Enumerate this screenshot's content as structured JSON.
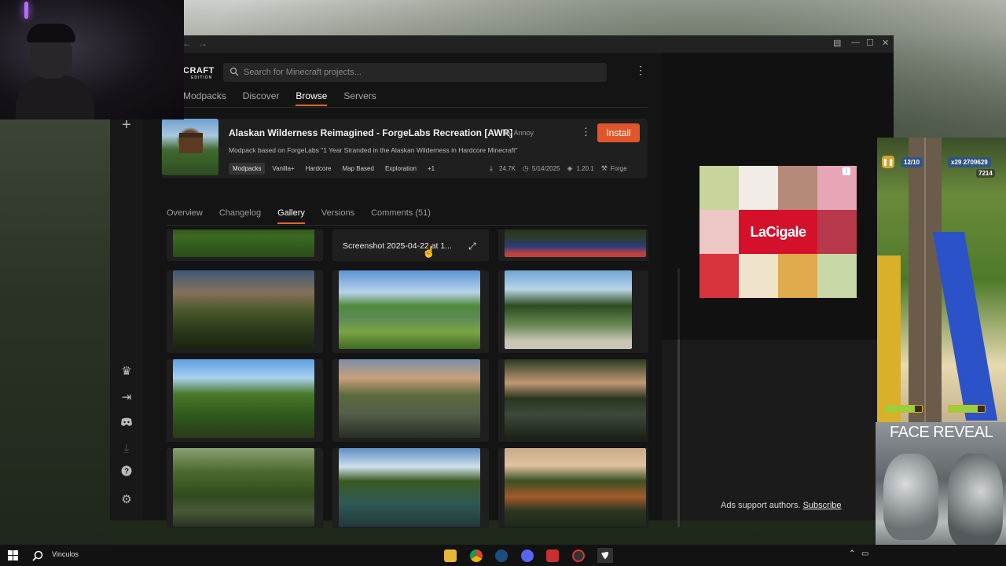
{
  "app": {
    "logo": "CRAFT",
    "logo_sub": "EDITION",
    "search_placeholder": "Search for Minecraft projects...",
    "nav_tabs": [
      "Modpacks",
      "Discover",
      "Browse",
      "Servers"
    ],
    "active_nav": "Browse"
  },
  "project": {
    "title": "Alaskan Wilderness Reimagined - ForgeLabs Recreation [AWR]",
    "author": "by Annoy",
    "install_label": "Install",
    "description": "Modpack based on ForgeLabs \"1 Year Stranded in the Alaskan Wilderness in Hardcore Minecraft\"",
    "tags": [
      "Modpacks",
      "Vanilla+",
      "Hardcore",
      "Map Based",
      "Exploration",
      "+1"
    ],
    "stats": {
      "downloads": "24.7K",
      "date": "5/14/2025",
      "version": "1.20.1",
      "loader": "Forge"
    }
  },
  "subtabs": [
    "Overview",
    "Changelog",
    "Gallery",
    "Versions",
    "Comments (51)"
  ],
  "active_subtab": "Gallery",
  "gallery": {
    "caption": "Screenshot 2025-04-22 at 1..."
  },
  "ad": {
    "brand": "LaCigale",
    "support_text": "Ads support authors.",
    "subscribe": "Subscribe",
    "swatch_colors": [
      "#c7d49c",
      "#f1ece6",
      "#b58a78",
      "#e7a6b6",
      "#ecc7c6",
      "#d4102b",
      "#d4102b",
      "#b8384c",
      "#d8343e",
      "#f0e3cc",
      "#e0a94b",
      "#c8d7a6"
    ]
  },
  "overlay": {
    "game_hud_keys": "12/10",
    "game_hud_coins": "x29",
    "game_hud_score": "2709629",
    "game_hud_sub": "7214",
    "face_reveal": "FACE REVEAL"
  },
  "taskbar": {
    "search_label": "Vinculos"
  },
  "colors": {
    "accent": "#e0562a",
    "tab_underline": "#e0672a"
  }
}
